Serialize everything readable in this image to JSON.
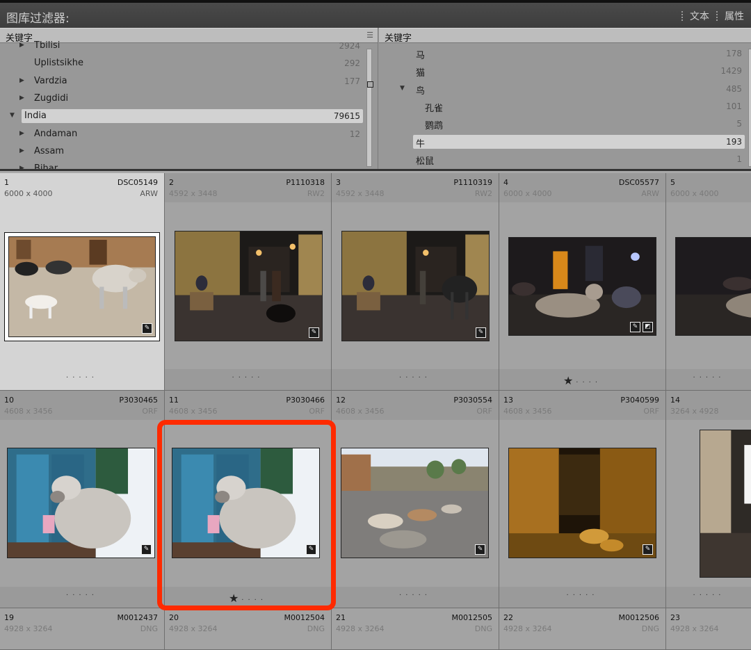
{
  "filter_bar": {
    "title": "图库过滤器:",
    "tabs": [
      "文本",
      "属性"
    ]
  },
  "left_column": {
    "header": "关键字",
    "rows": [
      {
        "label": "Tbilisi",
        "count": "2924",
        "expand": "collapsed",
        "level": 1
      },
      {
        "label": "Uplistsikhe",
        "count": "292",
        "expand": "none",
        "level": 1
      },
      {
        "label": "Vardzia",
        "count": "177",
        "expand": "collapsed",
        "level": 1
      },
      {
        "label": "Zugdidi",
        "count": "",
        "expand": "collapsed",
        "level": 1
      },
      {
        "label": "India",
        "count": "79615",
        "expand": "expanded",
        "level": 0,
        "selected": true
      },
      {
        "label": "Andaman",
        "count": "12",
        "expand": "collapsed",
        "level": 1
      },
      {
        "label": "Assam",
        "count": "",
        "expand": "collapsed",
        "level": 1
      },
      {
        "label": "Bihar",
        "count": "",
        "expand": "collapsed",
        "level": 1
      }
    ]
  },
  "right_column": {
    "header": "关键字",
    "rows": [
      {
        "label": "马",
        "count": "178",
        "expand": "none",
        "level": 0
      },
      {
        "label": "猫",
        "count": "1429",
        "expand": "none",
        "level": 0
      },
      {
        "label": "鸟",
        "count": "485",
        "expand": "expanded",
        "level": 0
      },
      {
        "label": "孔雀",
        "count": "101",
        "expand": "none",
        "level": 1
      },
      {
        "label": "鹦鹉",
        "count": "5",
        "expand": "none",
        "level": 1
      },
      {
        "label": "牛",
        "count": "193",
        "expand": "none",
        "level": 0,
        "selected": true
      },
      {
        "label": "松鼠",
        "count": "1",
        "expand": "none",
        "level": 0
      }
    ]
  },
  "grid": {
    "cells": [
      {
        "index": "1",
        "name": "DSC05149",
        "dims": "6000 x 4000",
        "ext": "ARW",
        "stars": 0,
        "scene": "cow-dog",
        "badges": [
          "edit"
        ],
        "selected": true
      },
      {
        "index": "2",
        "name": "P1110318",
        "dims": "4592 x 3448",
        "ext": "RW2",
        "stars": 0,
        "scene": "night-street",
        "badges": [
          "edit"
        ]
      },
      {
        "index": "3",
        "name": "P1110319",
        "dims": "4592 x 3448",
        "ext": "RW2",
        "stars": 0,
        "scene": "night-street-cow",
        "badges": [
          "edit"
        ]
      },
      {
        "index": "4",
        "name": "DSC05577",
        "dims": "6000 x 4000",
        "ext": "ARW",
        "stars": 1,
        "scene": "night-market",
        "badges": [
          "edit",
          "adjust"
        ]
      },
      {
        "index": "5",
        "name": "",
        "dims": "6000 x 4000",
        "ext": "",
        "stars": 0,
        "scene": "night-market-2",
        "badges": []
      },
      {
        "index": "10",
        "name": "P3030465",
        "dims": "4608 x 3456",
        "ext": "ORF",
        "stars": 0,
        "scene": "cow-door",
        "badges": [
          "edit"
        ]
      },
      {
        "index": "11",
        "name": "P3030466",
        "dims": "4608 x 3456",
        "ext": "ORF",
        "stars": 1,
        "scene": "cow-door",
        "badges": [
          "edit"
        ]
      },
      {
        "index": "12",
        "name": "P3030554",
        "dims": "4608 x 3456",
        "ext": "ORF",
        "stars": 0,
        "scene": "cows-road",
        "badges": [
          "edit"
        ]
      },
      {
        "index": "13",
        "name": "P3040599",
        "dims": "4608 x 3456",
        "ext": "ORF",
        "stars": 0,
        "scene": "amber-alley",
        "badges": [
          "edit"
        ]
      },
      {
        "index": "14",
        "name": "",
        "dims": "3264 x 4928",
        "ext": "",
        "stars": 0,
        "scene": "portrait-alley",
        "badges": []
      },
      {
        "index": "19",
        "name": "M0012437",
        "dims": "4928 x 3264",
        "ext": "DNG",
        "stars": 0,
        "scene": "",
        "badges": []
      },
      {
        "index": "20",
        "name": "M0012504",
        "dims": "4928 x 3264",
        "ext": "DNG",
        "stars": 0,
        "scene": "",
        "badges": []
      },
      {
        "index": "21",
        "name": "M0012505",
        "dims": "4928 x 3264",
        "ext": "DNG",
        "stars": 0,
        "scene": "",
        "badges": []
      },
      {
        "index": "22",
        "name": "M0012506",
        "dims": "4928 x 3264",
        "ext": "DNG",
        "stars": 0,
        "scene": "",
        "badges": []
      },
      {
        "index": "23",
        "name": "",
        "dims": "4928 x 3264",
        "ext": "",
        "stars": 0,
        "scene": "",
        "badges": []
      }
    ]
  },
  "colors": {
    "highlight": "#ff2a00",
    "selected_cell": "#d4d4d4",
    "cell": "#a3a3a3"
  }
}
